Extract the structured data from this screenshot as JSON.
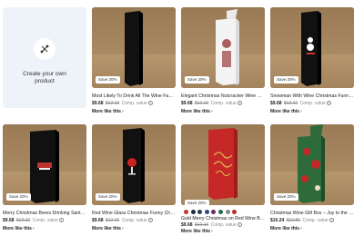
{
  "create_tile": {
    "label_line1": "Create your own",
    "label_line2": "product"
  },
  "products": [
    {
      "title": "Most Likely To Drink All The Wine Family ...",
      "price": "$9.68",
      "original": "$12.10",
      "comp": "Comp. value",
      "badge": "Save 20%",
      "more": "More like this"
    },
    {
      "title": "Elegant Christmas Nutcracker Wine Box ...",
      "price": "$9.68",
      "original": "$12.10",
      "comp": "Comp. value",
      "badge": "Save 20%",
      "more": "More like this"
    },
    {
      "title": "Snowman With Wine Christmas Funny X...",
      "price": "$9.68",
      "original": "$12.10",
      "comp": "Comp. value",
      "badge": "Save 20%",
      "more": "More like this"
    },
    {
      "title": "Merry Christmas Beers Drinking Santa B...",
      "price": "$9.68",
      "original": "$12.10",
      "comp": "Comp. value",
      "badge": "Save 20%",
      "more": "More like this"
    },
    {
      "title": "Red Wine Glass Christmas Funny Christm...",
      "price": "$9.68",
      "original": "$12.10",
      "comp": "Comp. value",
      "badge": "Save 20%",
      "more": "More like this"
    },
    {
      "title": "Gold Merry Christmas on Red Wine Box",
      "price": "$9.68",
      "original": "$12.10",
      "comp": "Comp. value",
      "badge": "Save 20%",
      "more": "More like this"
    },
    {
      "title": "Christmas Wine Gift Box – Joy to the Wor...",
      "price": "$10.24",
      "original": "$12.80",
      "comp": "Comp. value",
      "badge": "Save 20%",
      "more": "More like this"
    }
  ],
  "swatch_colors": [
    "#c0392b",
    "#1f2a44",
    "#2c3e50",
    "#2d4a8a",
    "#6b2a6b",
    "#1e6b4a",
    "#8a8a8a",
    "#b03030"
  ],
  "colors": {
    "create_bg": "#eef3fa",
    "box_red": "#c62828",
    "box_black": "#121212",
    "box_white": "#f4f4f4"
  }
}
